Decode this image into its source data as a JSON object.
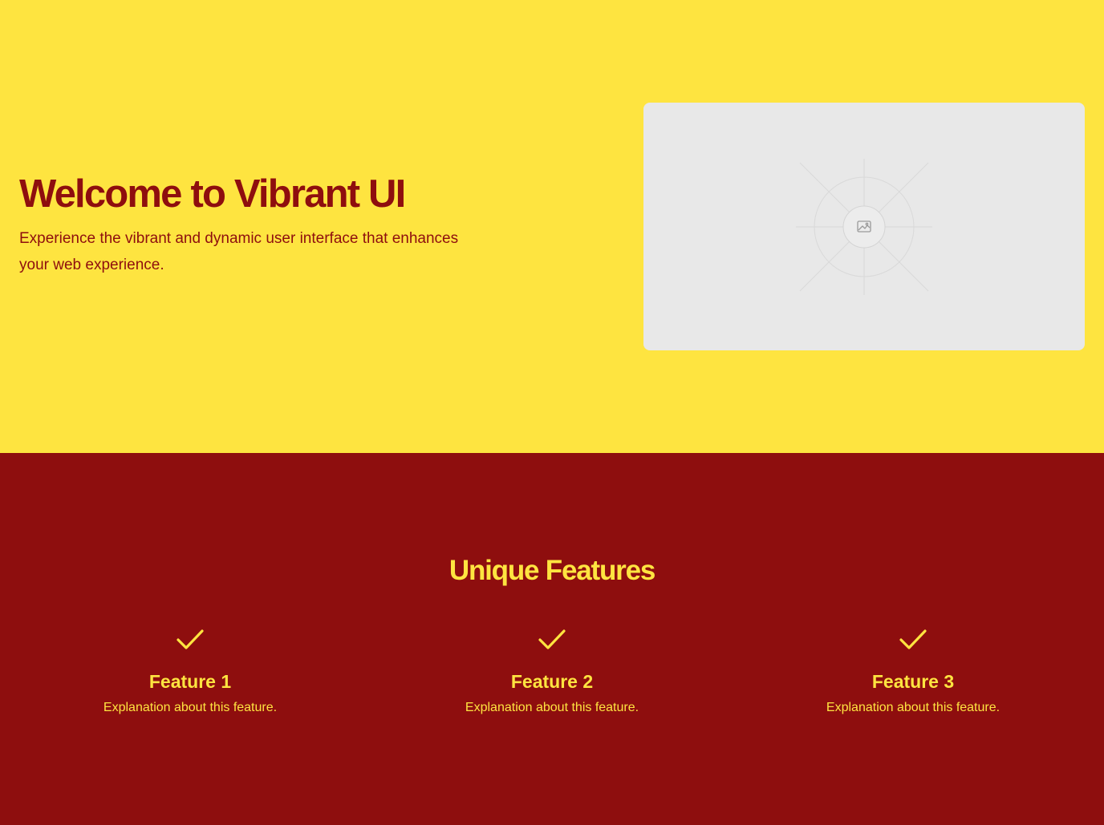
{
  "colors": {
    "hero_background": "#fee440",
    "accent_red": "#8e0e0e",
    "placeholder_gray": "#e8e8e8"
  },
  "hero": {
    "title": "Welcome to Vibrant UI",
    "subtitle": "Experience the vibrant and dynamic user interface that enhances your web experience.",
    "image_icon": "image-icon"
  },
  "features": {
    "title": "Unique Features",
    "icon": "checkmark-icon",
    "items": [
      {
        "name": "Feature 1",
        "description": "Explanation about this feature."
      },
      {
        "name": "Feature 2",
        "description": "Explanation about this feature."
      },
      {
        "name": "Feature 3",
        "description": "Explanation about this feature."
      }
    ]
  }
}
